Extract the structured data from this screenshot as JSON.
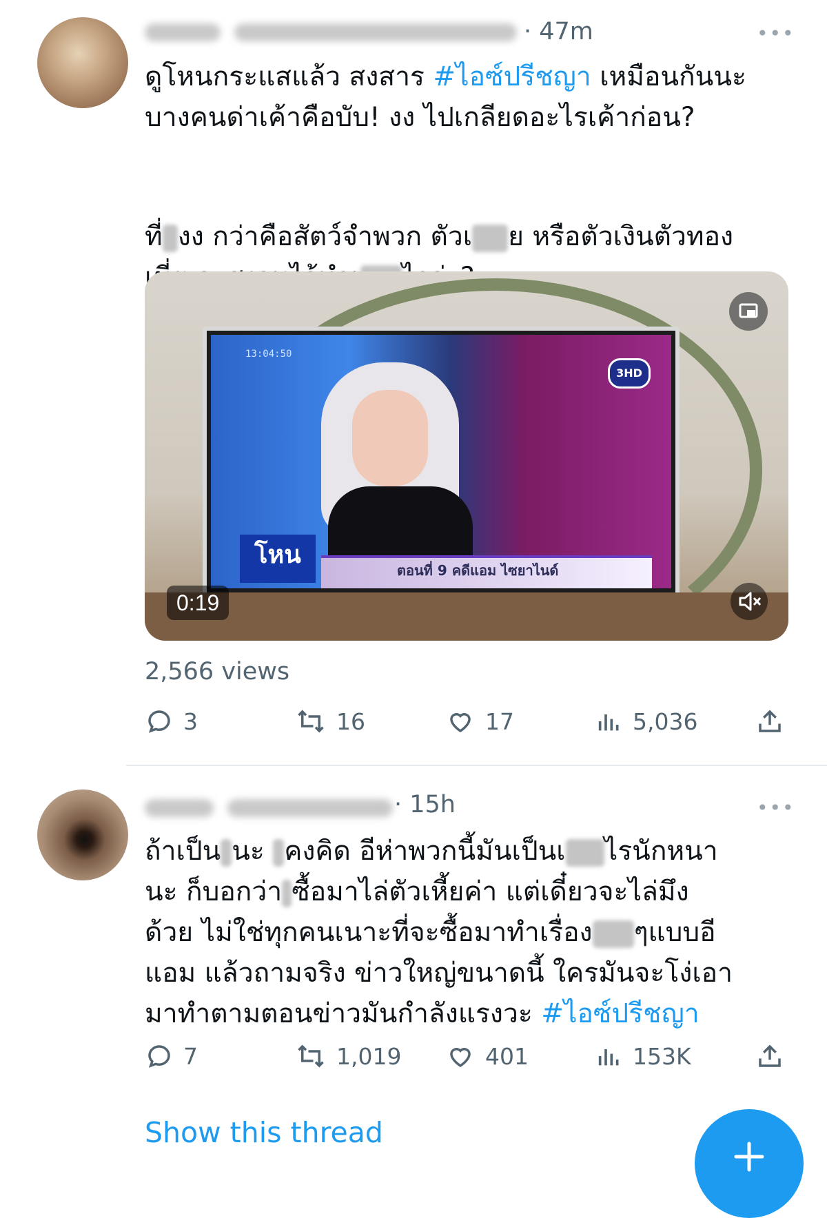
{
  "tweets": [
    {
      "time": "· 47m",
      "more": "•••",
      "lines": [
        [
          "ดูโหนกระแสแล้ว สงสาร ",
          "#ไอซ์ปรีชญา",
          " เหมือนกันนะ"
        ],
        [
          "บางคนด่าเค้าคือบับ! งง ไปเกลียดอะไรเค้าก่อน?"
        ],
        [
          "ที่",
          "งง กว่าคือสัตว์จำพวก ตัวเ",
          "ย หรือตัวเงินตัวทอง"
        ],
        [
          "เนี่ย จะสงวนไว้ทำเ",
          "ไรอ่ะ?"
        ]
      ],
      "video": {
        "duration": "0:19",
        "channel_logo": "3HD",
        "clock": "13:04:50",
        "show_logo": "โหน",
        "lower_third": "ตอนที่ 9 คดีแอม ไซยาไนด์"
      },
      "views": "2,566 views",
      "actions": {
        "replies": "3",
        "retweets": "16",
        "likes": "17",
        "view_count": "5,036"
      }
    },
    {
      "time": "· 15h",
      "more": "•••",
      "lines": [
        [
          "ถ้าเป็น",
          "นะ ",
          "คงคิด อีห่าพวกนี้มันเป็นเ",
          "ไรนักหนา"
        ],
        [
          "นะ ก็บอกว่า",
          "ซื้อมาไล่ตัวเหี้ยค่า แต่เดี๋ยวจะไล่มึง"
        ],
        [
          "ด้วย ไม่ใช่ทุกคนเนาะที่จะซื้อมาทำเรื่อง",
          "ๆแบบอี"
        ],
        [
          "แอม แล้วถามจริง ข่าวใหญ่ขนาดนี้ ใครมันจะโง่เอา"
        ],
        [
          "มาทำตามตอนข่าวมันกำลังแรงวะ ",
          "#ไอซ์ปรีชญา"
        ]
      ],
      "actions": {
        "replies": "7",
        "retweets": "1,019",
        "likes": "401",
        "view_count": "153K"
      }
    }
  ],
  "show_thread": "Show this thread",
  "colors": {
    "accent": "#1d9bf0",
    "muted": "#536471",
    "text": "#0f1419"
  },
  "icons": [
    "reply-icon",
    "retweet-icon",
    "like-icon",
    "views-icon",
    "share-icon",
    "more-icon",
    "mute-icon",
    "pip-icon",
    "compose-plus-icon"
  ]
}
